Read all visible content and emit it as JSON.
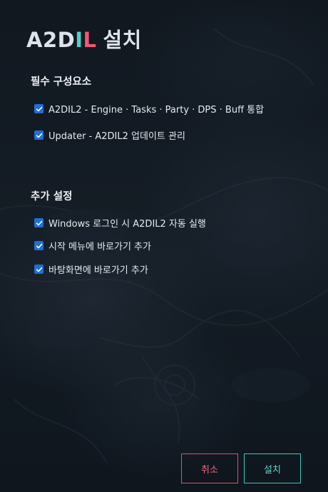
{
  "window": {
    "title_main": "A2D",
    "title_i": "I",
    "title_l": "L",
    "title_suffix": "설치",
    "accent_teal": "#4fd1c5",
    "accent_red": "#ef5a6f"
  },
  "required": {
    "heading": "필수 구성요소",
    "items": [
      {
        "label": "A2DIL2   -   Engine · Tasks · Party · DPS · Buff 통합",
        "checked": true
      },
      {
        "label": "Updater   -   A2DIL2 업데이트 관리",
        "checked": true
      }
    ]
  },
  "extra": {
    "heading": "추가 설정",
    "items": [
      {
        "label": "Windows 로그인 시 A2DIL2 자동 실행",
        "checked": true
      },
      {
        "label": "시작 메뉴에 바로가기 추가",
        "checked": true
      },
      {
        "label": "바탕화면에 바로가기 추가",
        "checked": true
      }
    ]
  },
  "buttons": {
    "cancel_label": "취소",
    "install_label": "설치"
  },
  "icons": {
    "checkbox": "checkmark-icon",
    "background": "decorative-background-art"
  }
}
